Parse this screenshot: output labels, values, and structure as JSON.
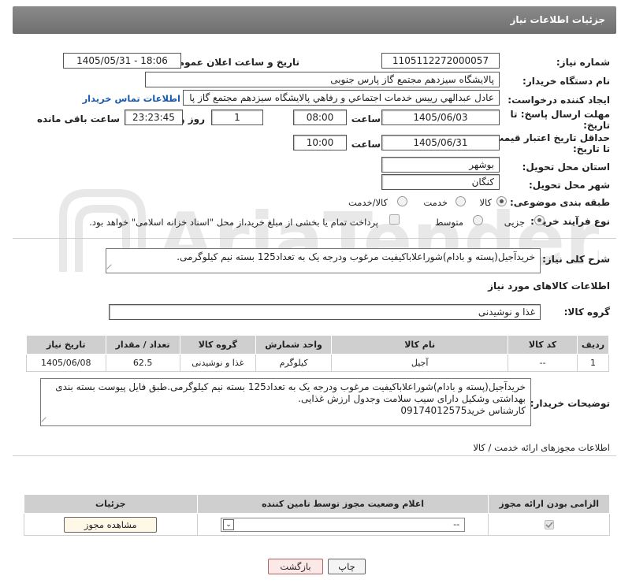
{
  "header": {
    "title": "جزئیات اطلاعات نیاز"
  },
  "form": {
    "need_number_label": "شماره نیاز:",
    "need_number": "1105112272000057",
    "announce_label": "تاریخ و ساعت اعلان عمومی:",
    "announce_value": "1405/05/31 - 18:06",
    "buyer_org_label": "نام دستگاه خریدار:",
    "buyer_org": "پالایشگاه سیزدهم مجتمع گاز پارس جنوبی",
    "requester_label": "ایجاد کننده درخواست:",
    "requester": "عادل عبدالهي رييس خدمات اجتماعي و رفاهي پالایشگاه سيزدهم مجتمع گاز پا",
    "contact_link": "اطلاعات تماس خریدار",
    "reply_deadline_label_1": "مهلت ارسال پاسخ: تا",
    "reply_deadline_label_2": "تاریخ:",
    "reply_date": "1405/06/03",
    "hour_label": "ساعت",
    "reply_time": "08:00",
    "days_value": "1",
    "days_label": "روز و",
    "remaining_time": "23:23:45",
    "remaining_label": "ساعت باقی مانده",
    "price_deadline_label_1": "حداقل تاریخ اعتبار قیمت:",
    "price_deadline_label_2": "تا تاریخ:",
    "price_date": "1405/06/31",
    "price_time": "10:00",
    "province_label": "استان محل تحویل:",
    "province": "بوشهر",
    "city_label": "شهر محل تحویل:",
    "city": "کنگان",
    "category_label": "طبقه بندی موضوعی:",
    "category_options": [
      "کالا",
      "خدمت",
      "کالا/خدمت"
    ],
    "process_label": "نوع فرآیند خرید :",
    "process_options": [
      "جزیی",
      "متوسط"
    ],
    "payment_note": "پرداخت تمام یا بخشی از مبلغ خرید،از محل \"اسناد خزانه اسلامی\" خواهد بود."
  },
  "description": {
    "label": "شرح کلی نیاز:",
    "text": "خریدآجیل(پسته و بادام)شوراعلاباکیفیت مرغوب ودرجه یک به تعداد125 بسته نیم کیلوگرمی."
  },
  "goods": {
    "section_title": "اطلاعات کالاهای مورد نیاز",
    "group_label": "گروه کالا:",
    "group_value": "غذا و نوشیدنی",
    "columns": [
      "ردیف",
      "کد کالا",
      "نام کالا",
      "واحد شمارش",
      "گروه کالا",
      "تعداد / مقدار",
      "تاریخ نیاز"
    ],
    "rows": [
      [
        "1",
        "--",
        "آجیل",
        "کیلوگرم",
        "غذا و نوشیدنی",
        "62.5",
        "1405/06/08"
      ]
    ]
  },
  "buyer_notes": {
    "label": "توضیحات خریدار:",
    "lines": [
      "خریدآجیل(پسته و بادام)شوراعلاباکیفیت مرغوب ودرجه یک به تعداد125 بسته نیم کیلوگرمی.طبق فایل پیوست بسته بندی",
      "بهداشتی وشکیل دارای سیب سلامت وجدول ارزش غذایی.",
      "کارشناس خرید09174012575"
    ]
  },
  "permits": {
    "section_title": "اطلاعات مجوزهای ارائه خدمت / کالا",
    "columns": [
      "الزامی بودن ارائه مجوز",
      "اعلام وضعیت مجوز توسط تامین کننده",
      "جزئیات"
    ],
    "select_value": "--",
    "view_button": "مشاهده مجوز"
  },
  "footer": {
    "print_button": "چاپ",
    "back_button": "بازگشت"
  },
  "watermark": {
    "text": "AriaTender.neT"
  }
}
